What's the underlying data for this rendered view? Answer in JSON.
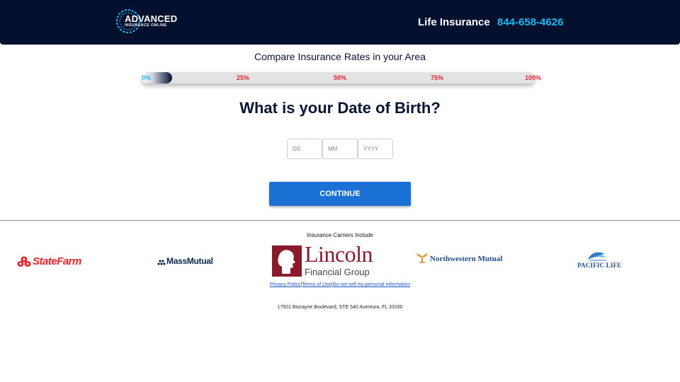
{
  "header": {
    "logo": {
      "main": "ADVANCED",
      "sub": "INSURANCE ONLINE"
    },
    "title": "Life Insurance",
    "phone": "844-658-4626",
    "background": "#04112e",
    "phone_color": "#1ab8f0"
  },
  "form": {
    "subtitle": "Compare Insurance Rates in your Area",
    "progress": {
      "value_percent": 0,
      "labels": [
        "0%",
        "25%",
        "50%",
        "75%",
        "100%"
      ],
      "active_label_color": "#1ab8f0",
      "label_color": "#e8222c"
    },
    "question": "What is your Date of Birth?",
    "fields": {
      "day": {
        "placeholder": "DD",
        "value": ""
      },
      "month": {
        "placeholder": "MM",
        "value": ""
      },
      "year": {
        "placeholder": "YYYY",
        "value": ""
      }
    },
    "continue_label": "CONTINUE",
    "button_color": "#1b72d4"
  },
  "footer": {
    "carriers_label": "Insurance Carriers Include",
    "carriers": [
      "StateFarm",
      "MassMutual",
      "Lincoln",
      "Northwestern Mutual",
      "PACIFIC LIFE"
    ],
    "carrier_subtitles": {
      "lincoln": "Financial Group"
    },
    "links": [
      "Privacy Policy",
      "Terms of Use",
      "Do not sell my personal information"
    ],
    "link_separator": "|",
    "address": "17501 Biscayne Boulevard, STE 540 Aventura, FL 33160"
  }
}
